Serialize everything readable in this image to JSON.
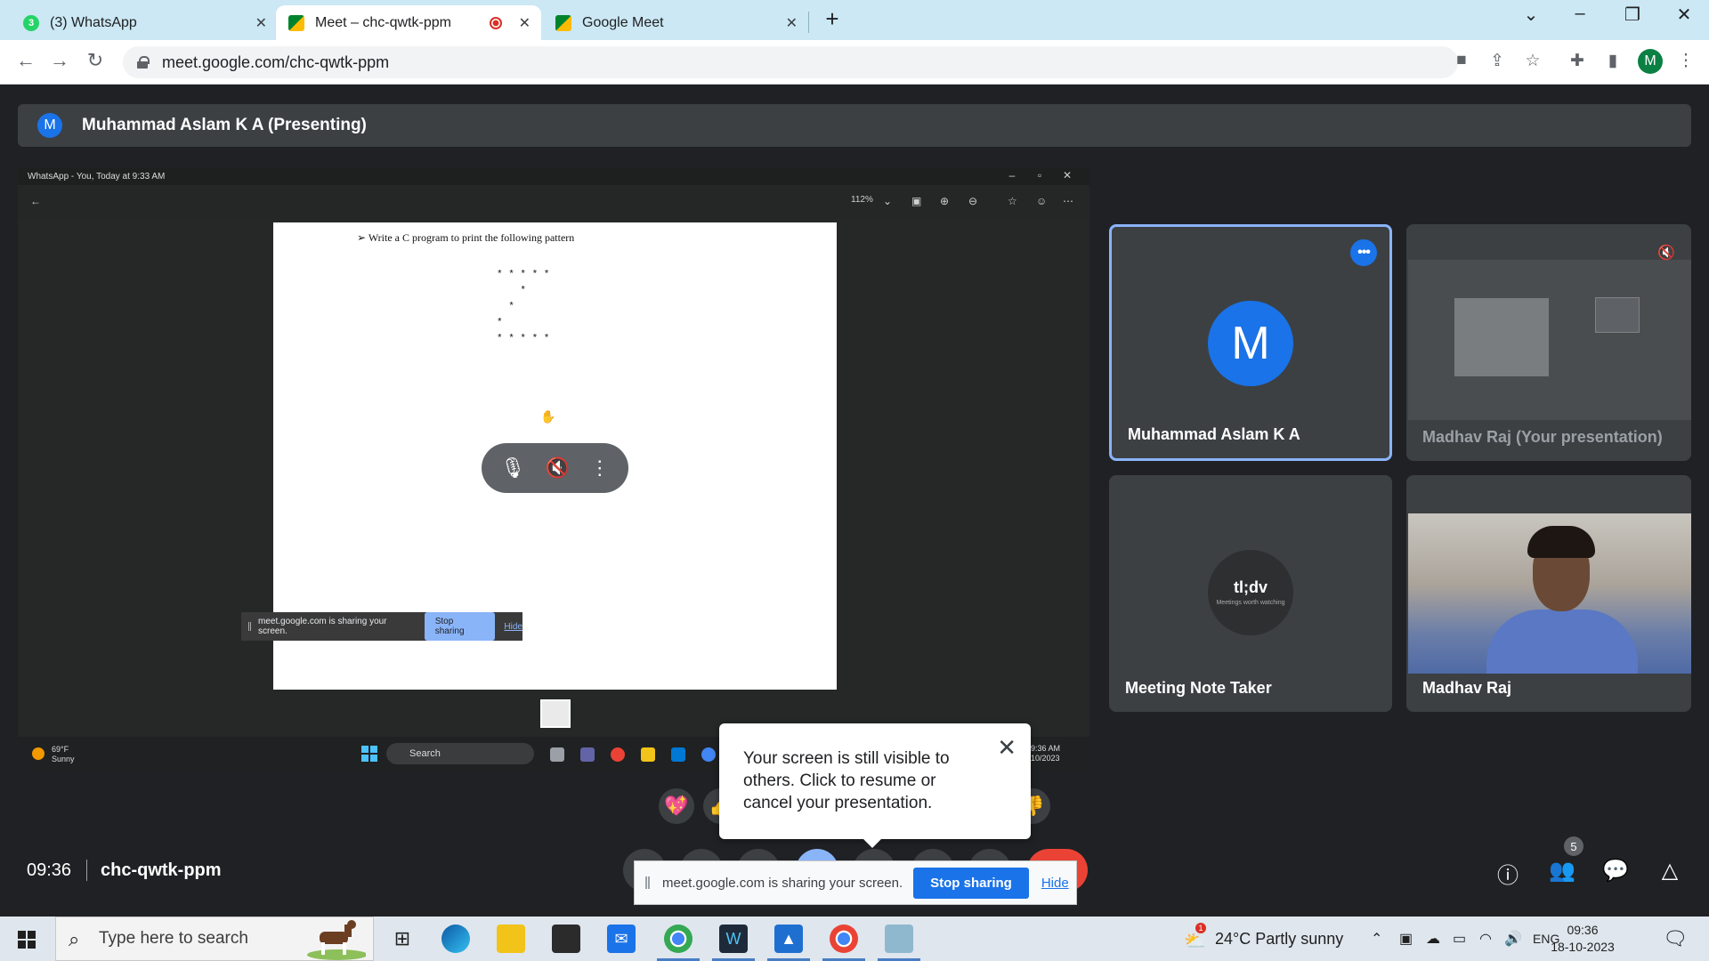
{
  "browser": {
    "tabs": [
      {
        "label": "(3) WhatsApp",
        "badge": "3"
      },
      {
        "label": "Meet – chc-qwtk-ppm"
      },
      {
        "label": "Google Meet"
      }
    ],
    "url": "meet.google.com/chc-qwtk-ppm",
    "profile_initial": "M"
  },
  "meet": {
    "presenter": {
      "initial": "M",
      "label": "Muhammad Aslam K A (Presenting)"
    },
    "shared_screen": {
      "title": "WhatsApp - You, Today at 9:33 AM",
      "zoom": "112%",
      "document_heading": "➢  Write a C program to print the following pattern",
      "pattern": "* * * * *\n    *\n  *\n*\n* * * * *",
      "mini_share_bar": {
        "text": "meet.google.com is sharing your screen.",
        "stop": "Stop sharing",
        "hide": "Hide"
      },
      "taskbar": {
        "temp": "69°F",
        "condition": "Sunny",
        "search": "Search",
        "time": "9:36 AM",
        "date": "10/2023"
      }
    },
    "participants": [
      {
        "name": "Muhammad Aslam K A",
        "initial": "M",
        "more": "•••"
      },
      {
        "name": "Madhav Raj (Your presentation)"
      },
      {
        "name": "Meeting Note Taker",
        "logo": "tl;dv",
        "tagline": "Meetings worth watching"
      },
      {
        "name": "Madhav Raj"
      }
    ],
    "tooltip": "Your screen is still visible to others. Click to resume or cancel your presentation.",
    "share_bar": {
      "text": "meet.google.com is sharing your screen.",
      "stop": "Stop sharing",
      "hide": "Hide"
    },
    "time": "09:36",
    "meeting_code": "chc-qwtk-ppm",
    "people_count": "5"
  },
  "taskbar": {
    "search_placeholder": "Type here to search",
    "weather": "24°C  Partly sunny",
    "weather_badge": "1",
    "language": "ENG",
    "time": "09:36",
    "date": "18-10-2023"
  },
  "colors": {
    "meet_bg": "#202124",
    "tile_bg": "#3c4043",
    "accent": "#1a73e8",
    "end_call": "#ea4335",
    "tab_strip": "#cbe8f4"
  }
}
